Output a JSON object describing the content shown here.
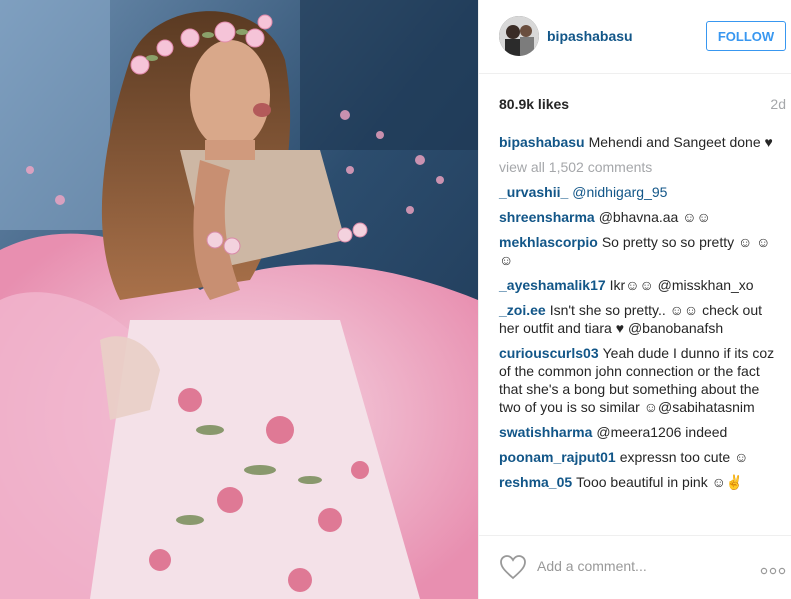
{
  "post": {
    "username": "bipashabasu",
    "follow_label": "FOLLOW",
    "likes": "80.9k likes",
    "time": "2d",
    "caption": {
      "user": "bipashabasu",
      "text": "Mehendi and Sangeet done ♥"
    },
    "view_all": "view all 1,502 comments",
    "comments": [
      {
        "user": "_urvashii_",
        "text": "@nidhigarg_95"
      },
      {
        "user": "shreensharma",
        "text": "@bhavna.aa ☺☺"
      },
      {
        "user": "mekhlascorpio",
        "text": "So pretty so so pretty ☺ ☺☺"
      },
      {
        "user": "_ayeshamalik17",
        "text": "Ikr☺☺ @misskhan_xo"
      },
      {
        "user": "_zoi.ee",
        "text": "Isn't she so pretty.. ☺☺ check out her outfit and tiara ♥ @banobanafsh"
      },
      {
        "user": "curiouscurls03",
        "text": "Yeah dude I dunno if its coz of the common john connection or the fact that she's a bong but something about the two of you is so similar ☺@sabihatasnim"
      },
      {
        "user": "swatishharma",
        "text": "@meera1206 indeed"
      },
      {
        "user": "poonam_rajput01",
        "text": "expressn too cute ☺"
      },
      {
        "user": "reshma_05",
        "text": "Tooo beautiful in pink ☺✌"
      }
    ],
    "add_comment_placeholder": "Add a comment..."
  },
  "icons": {
    "like": "heart-icon",
    "more": "more-options-icon"
  },
  "colors": {
    "link": "#125688",
    "follow": "#3897f0",
    "muted": "#a5a7aa"
  }
}
